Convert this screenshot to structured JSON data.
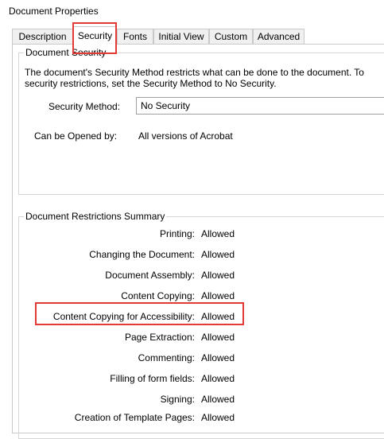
{
  "window": {
    "title": "Document Properties"
  },
  "tabs": [
    {
      "label": "Description"
    },
    {
      "label": "Security"
    },
    {
      "label": "Fonts"
    },
    {
      "label": "Initial View"
    },
    {
      "label": "Custom"
    },
    {
      "label": "Advanced"
    }
  ],
  "selected_tab": "Security",
  "security": {
    "group_title": "Document Security",
    "description_line1": "The document's Security Method restricts what can be done to the document. To",
    "description_line2": "security restrictions, set the Security Method to No Security.",
    "method_label": "Security Method:",
    "method_value": "No Security",
    "opened_by_label": "Can be Opened by:",
    "opened_by_value": "All versions of Acrobat"
  },
  "restrictions": {
    "group_title": "Document Restrictions Summary",
    "items": [
      {
        "label": "Printing:",
        "value": "Allowed"
      },
      {
        "label": "Changing the Document:",
        "value": "Allowed"
      },
      {
        "label": "Document Assembly:",
        "value": "Allowed"
      },
      {
        "label": "Content Copying:",
        "value": "Allowed"
      },
      {
        "label": "Content Copying for Accessibility:",
        "value": "Allowed"
      },
      {
        "label": "Page Extraction:",
        "value": "Allowed"
      },
      {
        "label": "Commenting:",
        "value": "Allowed"
      },
      {
        "label": "Filling of form fields:",
        "value": "Allowed"
      },
      {
        "label": "Signing:",
        "value": "Allowed"
      },
      {
        "label": "Creation of Template Pages:",
        "value": "Allowed"
      }
    ]
  },
  "annotations": {
    "highlight_color": "#e53935"
  }
}
